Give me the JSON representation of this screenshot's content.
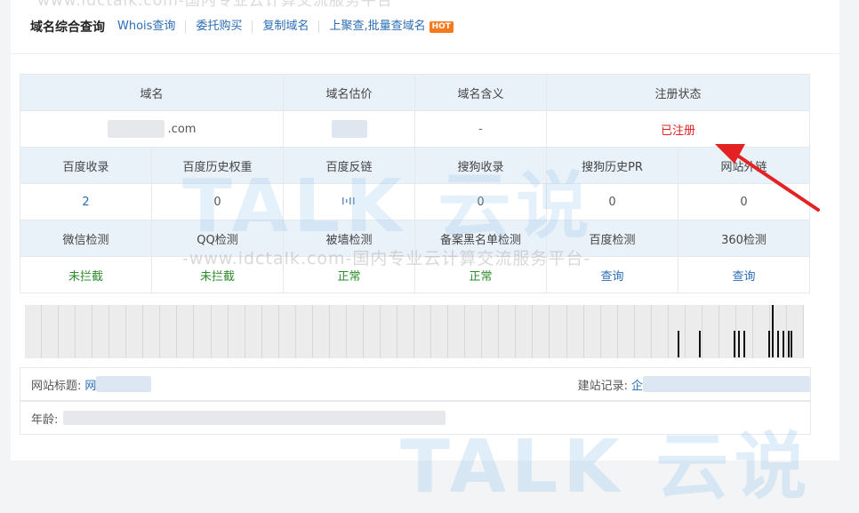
{
  "watermark": {
    "top": "www.idctalk.com-国内专业云计算交流服务平台",
    "logo": "TALK 云说",
    "middle": "-www.idctalk.com-国内专业云计算交流服务平台-",
    "bottom_logo": "TALK 云说"
  },
  "tabs": {
    "title": "域名综合查询",
    "links": [
      "Whois查询",
      "委托购买",
      "复制域名",
      "上聚查,批量查域名"
    ],
    "hot_badge": "HOT"
  },
  "table": {
    "row1_headers": [
      "域名",
      "域名估价",
      "域名含义",
      "注册状态"
    ],
    "row1_values": {
      "domain_suffix": ".com",
      "meaning": "-",
      "status": "已注册"
    },
    "row2_headers": [
      "百度收录",
      "百度历史权重",
      "百度反链",
      "搜狗收录",
      "搜狗历史PR",
      "网站外链"
    ],
    "row2_values": [
      "2",
      "0",
      "",
      "0",
      "0",
      "0"
    ],
    "row3_headers": [
      "微信检测",
      "QQ检测",
      "被墙检测",
      "备案黑名单检测",
      "百度检测",
      "360检测"
    ],
    "row3_values": [
      "未拦截",
      "未拦截",
      "正常",
      "正常",
      "查询",
      "查询"
    ]
  },
  "colors": {
    "blue": "#2a6db5",
    "red": "#e02020",
    "green": "#2e8b2e",
    "header_bg": "#e9f1f9",
    "arrow": "#e52222"
  },
  "info": {
    "site_title_label": "网站标题:",
    "site_title_value": "网",
    "record_label": "建站记录:",
    "record_value": "企",
    "age_label": "年龄:"
  }
}
